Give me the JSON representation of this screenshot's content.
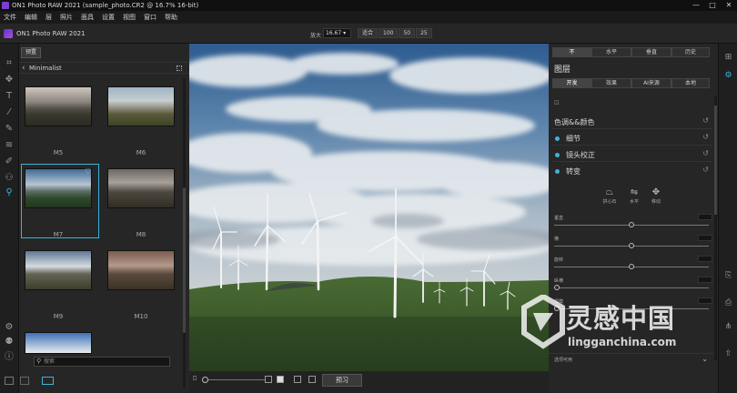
{
  "window": {
    "title": "ON1 Photo RAW 2021 (sample_photo.CR2 @ 16.7% 16-bit)",
    "controls": [
      "—",
      "□",
      "✕"
    ]
  },
  "menu": [
    "文件",
    "编辑",
    "层",
    "照片",
    "面具",
    "设置",
    "视图",
    "窗口",
    "帮助"
  ],
  "toolbar": {
    "brand": "ON1 Photo RAW 2021",
    "zoom_label": "放大",
    "zoom_value": "16.67",
    "zoom_buttons": [
      "适合",
      "100",
      "50",
      "25"
    ]
  },
  "browser": {
    "tab": "预置",
    "category": "Minimalist",
    "presets": [
      {
        "label": "M5"
      },
      {
        "label": "M6"
      },
      {
        "label": "M7",
        "selected": true,
        "favorite": true
      },
      {
        "label": "M8"
      },
      {
        "label": "M9"
      },
      {
        "label": "M10"
      }
    ],
    "search_placeholder": "搜索"
  },
  "canvas_bar": {
    "preview_button": "预习"
  },
  "right_panel": {
    "top_tabs": [
      "不",
      "水平",
      "垂直",
      "历史"
    ],
    "title": "图层",
    "sub_tabs": [
      "开发",
      "效果",
      "AI来源",
      "本地"
    ],
    "sections": [
      {
        "label": "色调&&颜色",
        "dot": false
      },
      {
        "label": "细节",
        "dot": true
      },
      {
        "label": "镜头校正",
        "dot": true
      },
      {
        "label": "转变",
        "dot": true
      }
    ],
    "tools": [
      {
        "label": "拱心石",
        "icon": "keystone-icon"
      },
      {
        "label": "水平",
        "icon": "level-icon"
      },
      {
        "label": "移动",
        "icon": "move-icon"
      }
    ],
    "sliders": [
      {
        "name": "垂直",
        "value": 0.5
      },
      {
        "name": "横",
        "value": 0.5
      },
      {
        "name": "旋转",
        "value": 0.5
      },
      {
        "name": "纵横",
        "value": 0.0
      },
      {
        "name": "规模",
        "value": 0.0
      }
    ],
    "footer": "选项可用"
  },
  "watermark": {
    "cn": "灵感中国",
    "url": "lingganchina.com"
  },
  "colors": {
    "accent": "#3fb3d8",
    "panel": "#262626",
    "brand": "#7a3fd0"
  }
}
